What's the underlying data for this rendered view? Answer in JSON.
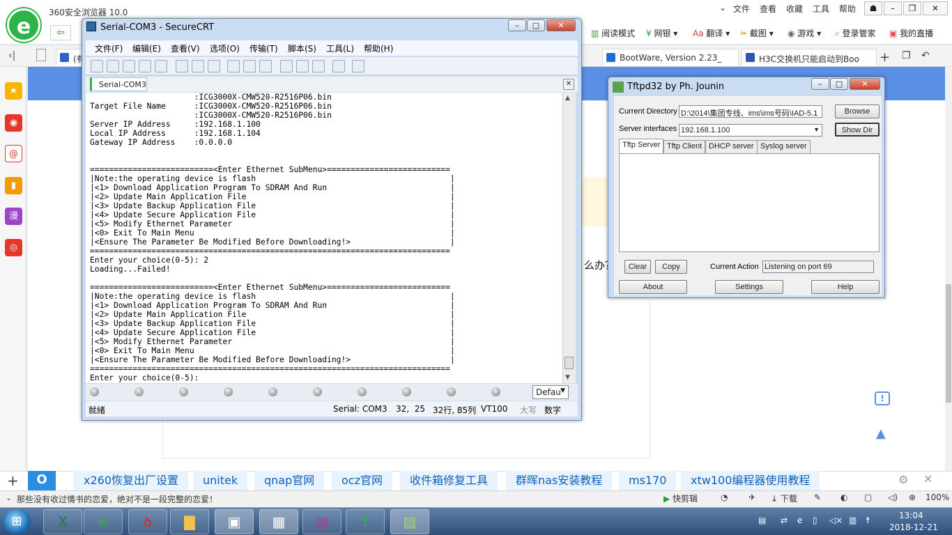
{
  "browser": {
    "title": "360安全浏览器 10.0",
    "menu": [
      "文件",
      "查看",
      "收藏",
      "工具",
      "帮助"
    ],
    "nav_tools": [
      "阅读模式",
      "网银",
      "翻译",
      "截图",
      "游戏",
      "登录管家",
      "我的直播"
    ],
    "tabs": [
      "(有",
      "BootWare, Version 2.23_",
      "H3C交换机只能启动到Boo"
    ],
    "page_text": "么办？",
    "bookmarks": [
      "x260恢复出厂设置",
      "unitek",
      "qnap官网",
      "ocz官网",
      "收件箱修复工具",
      "群晖nas安装教程",
      "ms170",
      "xtw100编程器使用教程"
    ],
    "status_text": "那些没有收过情书的恋爱，绝对不是一段完整的恋爱！",
    "status_tools": [
      "快剪辑",
      "下载",
      "100%"
    ]
  },
  "securecrt": {
    "title": "Serial-COM3 - SecureCRT",
    "menu": [
      "文件(F)",
      "编辑(E)",
      "查看(V)",
      "选项(O)",
      "传输(T)",
      "脚本(S)",
      "工具(L)",
      "帮助(H)"
    ],
    "tab_label": "Serial-COM3",
    "terminal_lines": [
      "                      :ICG3000X-CMW520-R2516P06.bin",
      "Target File Name      :ICG3000X-CMW520-R2516P06.bin",
      "                      :ICG3000X-CMW520-R2516P06.bin",
      "Server IP Address     :192.168.1.100",
      "Local IP Address      :192.168.1.104",
      "Gateway IP Address    :0.0.0.0",
      "",
      "",
      "==========================<Enter Ethernet SubMenu>==========================",
      "|Note:the operating device is flash                                         |",
      "|<1> Download Application Program To SDRAM And Run                          |",
      "|<2> Update Main Application File                                           |",
      "|<3> Update Backup Application File                                         |",
      "|<4> Update Secure Application File                                         |",
      "|<5> Modify Ethernet Parameter                                              |",
      "|<0> Exit To Main Menu                                                      |",
      "|<Ensure The Parameter Be Modified Before Downloading!>                     |",
      "============================================================================",
      "Enter your choice(0-5): 2",
      "Loading...Failed!",
      "",
      "==========================<Enter Ethernet SubMenu>==========================",
      "|Note:the operating device is flash                                         |",
      "|<1> Download Application Program To SDRAM And Run                          |",
      "|<2> Update Main Application File                                           |",
      "|<3> Update Backup Application File                                         |",
      "|<4> Update Secure Application File                                         |",
      "|<5> Modify Ethernet Parameter                                              |",
      "|<0> Exit To Main Menu                                                      |",
      "|<Ensure The Parameter Be Modified Before Downloading!>                     |",
      "============================================================================",
      "Enter your choice(0-5):"
    ],
    "button_bar_select": "Defau",
    "status": {
      "ready": "就绪",
      "session": "Serial: COM3",
      "cursor": "32,  25",
      "size": "32行, 85列",
      "term": "VT100",
      "caps": "大写",
      "num": "数字"
    }
  },
  "tftpd": {
    "title": "Tftpd32 by Ph. Jounin",
    "current_directory_label": "Current Directory",
    "current_directory": "D:\\2014\\集团专线、ims\\ims号码\\IAD-5.1",
    "browse": "Browse",
    "server_interfaces_label": "Server interfaces",
    "server_interface": "192.168.1.100",
    "show_dir": "Show Dir",
    "tabs": [
      "Tftp Server",
      "Tftp Client",
      "DHCP server",
      "Syslog server"
    ],
    "clear": "Clear",
    "copy": "Copy",
    "current_action_label": "Current Action",
    "current_action": "Listening on port 69",
    "about": "About",
    "settings": "Settings",
    "help": "Help"
  },
  "taskbar": {
    "time": "13:04",
    "date": "2018-12-21"
  }
}
